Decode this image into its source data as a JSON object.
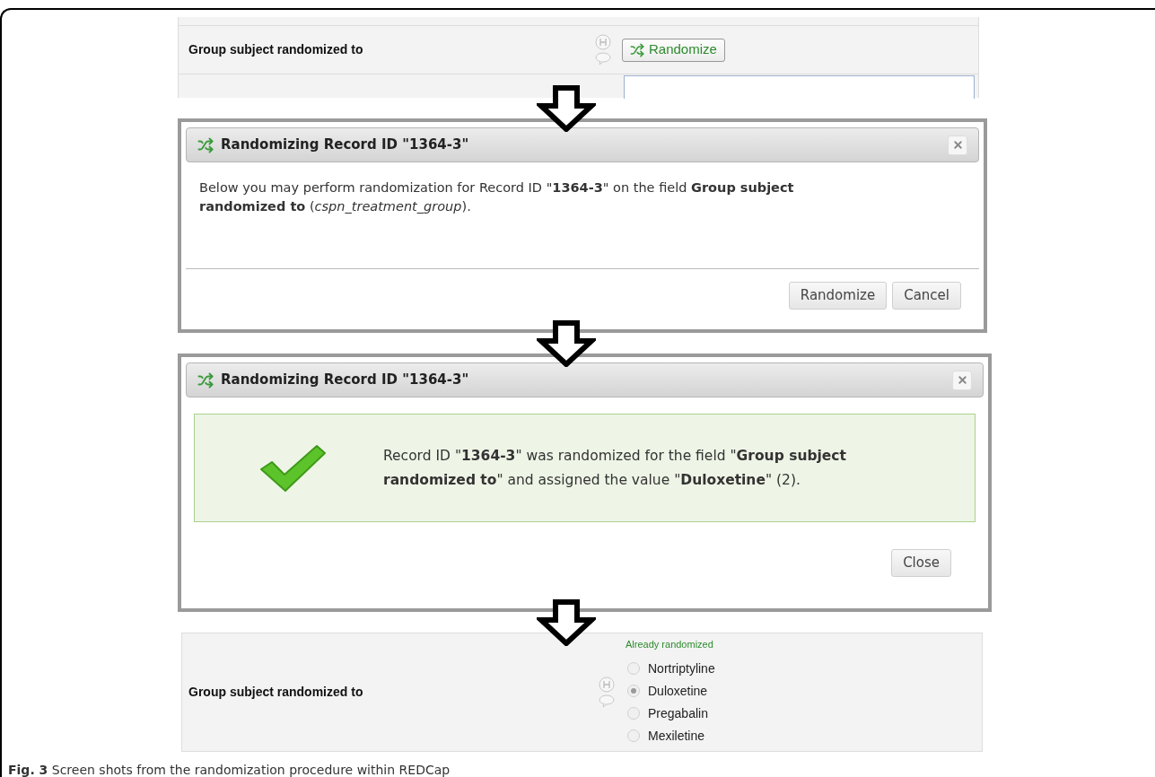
{
  "field_before": {
    "label": "Group subject randomized to",
    "button": "Randomize"
  },
  "dialog_confirm": {
    "title": "Randomizing Record ID \"1364-3\"",
    "message": "Below you may perform randomization for Record ID \"**1364-3**\" on the field **Group subject randomized to** (*cspn_treatment_group*).",
    "buttons": [
      "Randomize",
      "Cancel"
    ]
  },
  "dialog_result": {
    "title": "Randomizing Record ID \"1364-3\"",
    "message": "Record ID \"**1364-3**\" was randomized for the field \"**Group subject randomized to**\" and assigned the value \"**Duloxetine**\" (2).",
    "buttons": [
      "Close"
    ]
  },
  "field_after": {
    "label": "Group subject randomized to",
    "note": "Already randomized",
    "options": [
      {
        "label": "Nortriptyline",
        "selected": false
      },
      {
        "label": "Duloxetine",
        "selected": true
      },
      {
        "label": "Pregabalin",
        "selected": false
      },
      {
        "label": "Mexiletine",
        "selected": false
      }
    ]
  },
  "caption": "**Fig. 3** Screen shots from the randomization procedure within REDCap"
}
